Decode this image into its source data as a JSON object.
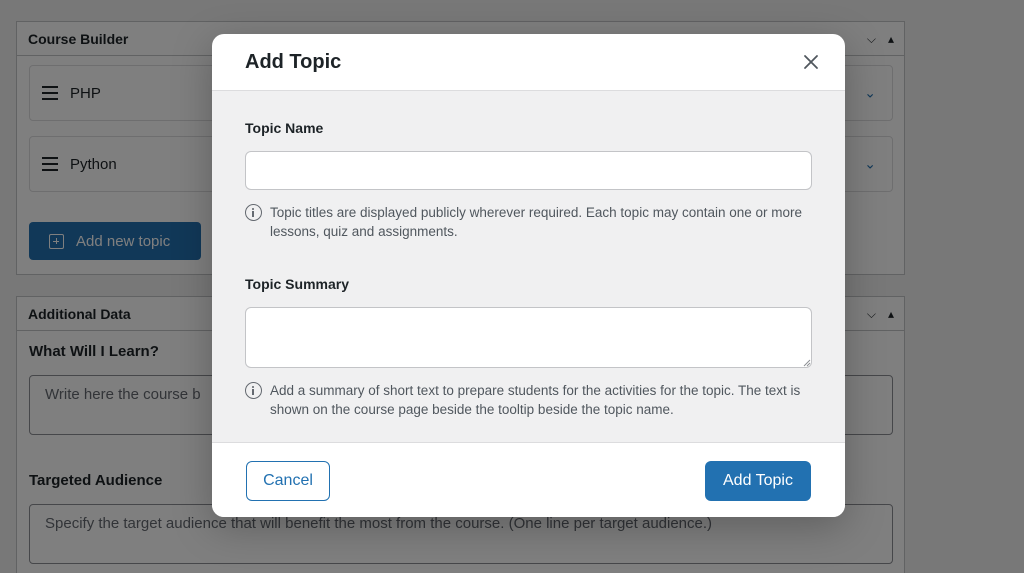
{
  "background": {
    "course_builder": {
      "title": "Course Builder",
      "topics": [
        {
          "name": "PHP"
        },
        {
          "name": "Python"
        }
      ],
      "add_new_topic_label": "Add new topic"
    },
    "additional_data": {
      "title": "Additional Data",
      "learn_label": "What Will I Learn?",
      "learn_placeholder": "Write here the course b",
      "audience_label": "Targeted Audience",
      "audience_placeholder": "Specify the target audience that will benefit the most from the course. (One line per target audience.)"
    },
    "colors": {
      "accent": "#2271b1",
      "overlay": "rgba(0,0,0,0.5)"
    }
  },
  "modal": {
    "title": "Add Topic",
    "close_icon": "close-icon",
    "topic_name": {
      "label": "Topic Name",
      "value": "",
      "help": "Topic titles are displayed publicly wherever required. Each topic may contain one or more lessons, quiz and assignments."
    },
    "topic_summary": {
      "label": "Topic Summary",
      "value": "",
      "help": "Add a summary of short text to prepare students for the activities for the topic. The text is shown on the course page beside the tooltip beside the topic name."
    },
    "cancel_label": "Cancel",
    "submit_label": "Add Topic"
  }
}
